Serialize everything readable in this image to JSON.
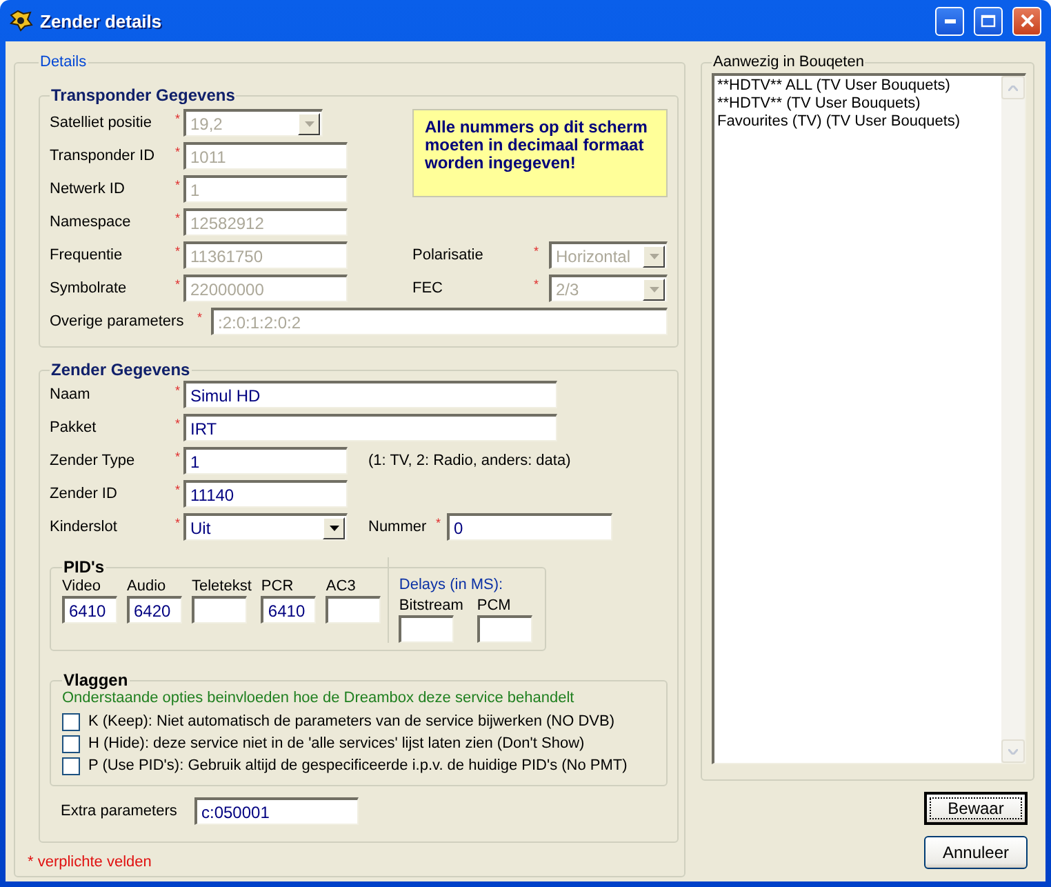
{
  "window": {
    "title": "Zender details"
  },
  "details": {
    "title": "Details",
    "transponder": {
      "title": "Transponder Gegevens",
      "note": "Alle nummers op dit scherm moeten in decimaal formaat worden ingegeven!",
      "rows": [
        [
          {
            "label": "Satelliet positie",
            "mark": "*",
            "kind": "combo",
            "value": "19,2",
            "disabled": true
          }
        ],
        [
          {
            "label": "Transponder ID",
            "mark": "*",
            "kind": "text",
            "value": "1011",
            "disabled": true
          }
        ],
        [
          {
            "label": "Netwerk ID",
            "mark": "*",
            "kind": "text",
            "value": "1",
            "disabled": true
          }
        ],
        [
          {
            "label": "Namespace",
            "mark": "*",
            "kind": "text",
            "value": "12582912",
            "disabled": true
          }
        ],
        [
          {
            "label": "Frequentie",
            "mark": "*",
            "kind": "text",
            "value": "11361750",
            "disabled": true
          },
          {
            "label": "Polarisatie",
            "mark": "*",
            "kind": "combo",
            "value": "Horizontal",
            "disabled": true
          }
        ],
        [
          {
            "label": "Symbolrate",
            "mark": "*",
            "kind": "text",
            "value": "22000000",
            "disabled": true
          },
          {
            "label": "FEC",
            "mark": "*",
            "kind": "combo",
            "value": "2/3",
            "disabled": true
          }
        ]
      ],
      "other": {
        "label": "Overige parameters",
        "mark": "*",
        "kind": "text",
        "value": ":2:0:1:2:0:2",
        "disabled": true
      }
    },
    "zender": {
      "title": "Zender Gegevens",
      "rows": [
        [
          {
            "label": "Naam",
            "mark": "*",
            "kind": "wide",
            "value": "Simul HD",
            "disabled": false
          }
        ],
        [
          {
            "label": "Pakket",
            "mark": "*",
            "kind": "wide",
            "value": "IRT",
            "disabled": false
          }
        ],
        [
          {
            "label": "Zender Type",
            "mark": "*",
            "kind": "text",
            "value": "1",
            "disabled": false,
            "hint": "(1: TV, 2: Radio, anders: data)"
          }
        ],
        [
          {
            "label": "Zender ID",
            "mark": "*",
            "kind": "text",
            "value": "11140",
            "disabled": false
          }
        ],
        [
          {
            "label": "Kinderslot",
            "mark": "*",
            "kind": "combo",
            "value": "Uit",
            "disabled": false
          },
          {
            "label": "Nummer",
            "mark": "*",
            "kind": "text",
            "value": "0",
            "disabled": false
          }
        ]
      ],
      "pids": {
        "title": "PID's",
        "fields": [
          {
            "label": "Video",
            "value": "6410"
          },
          {
            "label": "Audio",
            "value": "6420"
          },
          {
            "label": "Teletekst"
          },
          {
            "label": "PCR",
            "value": "6410"
          },
          {
            "label": "AC3"
          }
        ],
        "delays": {
          "title": "Delays (in MS):",
          "fields": [
            {
              "label": "Bitstream"
            },
            {
              "label": "PCM"
            }
          ]
        }
      },
      "flags": {
        "title": "Vlaggen",
        "intro": "Onderstaande opties beinvloeden hoe de Dreambox deze service behandelt",
        "options": [
          {
            "label": "K (Keep): Niet automatisch de parameters van de service bijwerken (NO DVB)",
            "checked": false
          },
          {
            "label": "H (Hide): deze service niet in de 'alle services' lijst laten zien (Don't Show)",
            "checked": false
          },
          {
            "label": "P (Use PID's): Gebruik altijd de gespecificeerde i.p.v. de huidige PID's (No PMT)",
            "checked": false
          }
        ]
      },
      "extra": {
        "label": "Extra parameters",
        "value": "c:050001"
      }
    },
    "legend": "* verplichte velden"
  },
  "bouquets": {
    "title": "Aanwezig in Bouqeten",
    "items": [
      "**HDTV**  ALL (TV User Bouquets)",
      "**HDTV** (TV User Bouquets)",
      "Favourites (TV) (TV User Bouquets)"
    ]
  },
  "buttons": [
    {
      "label": "Bewaar",
      "focused": true
    },
    {
      "label": "Annuleer",
      "focused": false
    }
  ]
}
